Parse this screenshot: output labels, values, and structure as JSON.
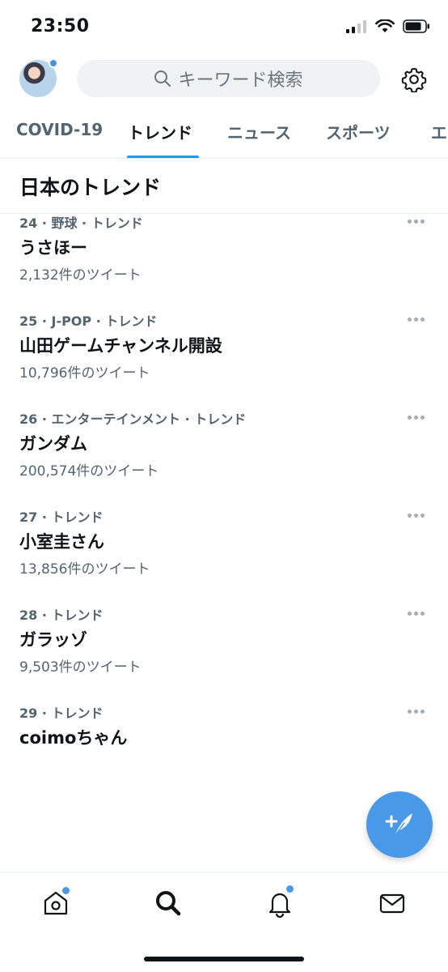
{
  "status_bar": {
    "time": "23:50"
  },
  "search": {
    "placeholder": "キーワード検索"
  },
  "tabs": [
    {
      "label": "COVID-19"
    },
    {
      "label": "トレンド",
      "active": true
    },
    {
      "label": "ニュース"
    },
    {
      "label": "スポーツ"
    },
    {
      "label": "エ"
    }
  ],
  "section": {
    "title": "日本のトレンド"
  },
  "trends": [
    {
      "meta": "24 · 野球 · トレンド",
      "name": "うさほー",
      "count": "2,132件のツイート"
    },
    {
      "meta": "25 · J-POP · トレンド",
      "name": "山田ゲームチャンネル開設",
      "count": "10,796件のツイート"
    },
    {
      "meta": "26 · エンターテインメント · トレンド",
      "name": "ガンダム",
      "count": "200,574件のツイート"
    },
    {
      "meta": "27 · トレンド",
      "name": "小室圭さん",
      "count": "13,856件のツイート"
    },
    {
      "meta": "28 · トレンド",
      "name": "ガラッゾ",
      "count": "9,503件のツイート"
    },
    {
      "meta": "29 · トレンド",
      "name": "coimoちゃん",
      "count": ""
    }
  ],
  "colors": {
    "accent": "#1d9bf0",
    "fab": "#4a99e9",
    "muted": "#536471"
  },
  "icons": [
    "search-icon",
    "gear-icon",
    "compose-icon",
    "home-icon",
    "explore-search-icon",
    "bell-icon",
    "mail-icon"
  ]
}
